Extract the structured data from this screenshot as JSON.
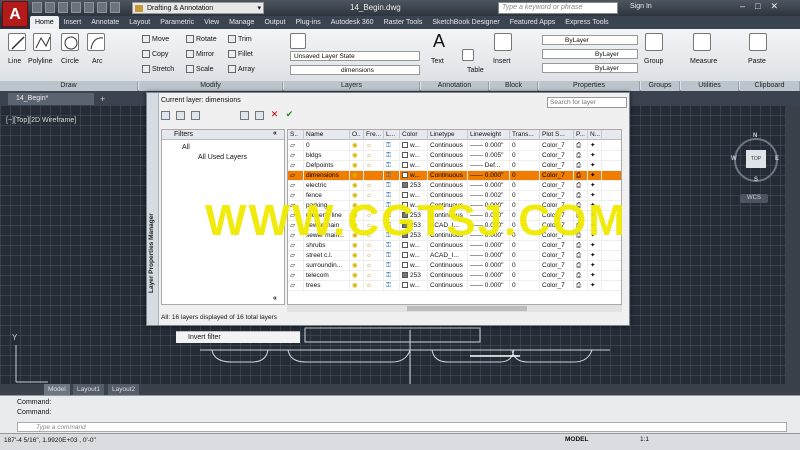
{
  "app": {
    "logo_letter": "A",
    "workspace": "Drafting & Annotation",
    "doc_title": "14_Begin.dwg",
    "search_placeholder": "Type a keyword or phrase",
    "sign_in": "Sign In"
  },
  "tabs": [
    "Home",
    "Insert",
    "Annotate",
    "Layout",
    "Parametric",
    "View",
    "Manage",
    "Output",
    "Plug-ins",
    "Autodesk 360",
    "Raster Tools",
    "SketchBook Designer",
    "Featured Apps",
    "Express Tools"
  ],
  "ribbon": {
    "draw": {
      "line": "Line",
      "polyline": "Polyline",
      "circle": "Circle",
      "arc": "Arc",
      "panel": "Draw"
    },
    "modify": {
      "move": "Move",
      "rotate": "Rotate",
      "trim": "Trim",
      "copy": "Copy",
      "mirror": "Mirror",
      "fillet": "Fillet",
      "stretch": "Stretch",
      "scale": "Scale",
      "array": "Array",
      "panel": "Modify"
    },
    "layers": {
      "state": "Unsaved Layer State",
      "current": "dimensions",
      "panel": "Layers"
    },
    "annotation": {
      "text": "Text",
      "table": "Table",
      "panel": "Annotation"
    },
    "block": {
      "insert": "Insert",
      "panel": "Block"
    },
    "properties": {
      "color": "ByLayer",
      "linetype": "ByLayer",
      "lineweight": "ByLayer",
      "panel": "Properties"
    },
    "groups": {
      "group": "Group",
      "panel": "Groups"
    },
    "utilities": {
      "measure": "Measure",
      "panel": "Utilities"
    },
    "clipboard": {
      "paste": "Paste",
      "panel": "Clipboard"
    }
  },
  "doc_tab": "14_Begin*",
  "view_label": "[−][Top][2D Wireframe]",
  "navcube": {
    "top": "TOP",
    "n": "N",
    "s": "S",
    "e": "E",
    "w": "W",
    "wcs": "WCS"
  },
  "layer_manager": {
    "side_title": "Layer Properties Manager",
    "current_layer": "Current layer: dimensions",
    "search_placeholder": "Search for layer",
    "filters_header": "Filters",
    "filter_all": "All",
    "filter_used": "All Used Layers",
    "invert_filter": "Invert filter",
    "columns": [
      "S..",
      "Name",
      "O..",
      "Fre...",
      "L...",
      "Color",
      "Linetype",
      "Lineweight",
      "Trans...",
      "Plot S...",
      "P...",
      "N..."
    ],
    "rows": [
      {
        "name": "0",
        "color": "w...",
        "linetype": "Continuous",
        "lineweight": "0.000\"",
        "trans": "0",
        "plot": "Color_7"
      },
      {
        "name": "bldgs",
        "color": "w...",
        "linetype": "Continuous",
        "lineweight": "0.005\"",
        "trans": "0",
        "plot": "Color_7"
      },
      {
        "name": "Defpoints",
        "color": "w...",
        "linetype": "Continuous",
        "lineweight": "Def...",
        "trans": "0",
        "plot": "Color_7"
      },
      {
        "name": "dimensions",
        "color": "w...",
        "linetype": "Continuous",
        "lineweight": "0.000\"",
        "trans": "0",
        "plot": "Color_7"
      },
      {
        "name": "electric",
        "color": "253",
        "linetype": "Continuous",
        "lineweight": "0.000\"",
        "trans": "0",
        "plot": "Color_7"
      },
      {
        "name": "fence",
        "color": "w...",
        "linetype": "Continuous",
        "lineweight": "0.002\"",
        "trans": "0",
        "plot": "Color_7"
      },
      {
        "name": "parking",
        "color": "w...",
        "linetype": "Continuous",
        "lineweight": "0.000\"",
        "trans": "0",
        "plot": "Color_7"
      },
      {
        "name": "property line",
        "color": "253",
        "linetype": "Continuous",
        "lineweight": "0.000\"",
        "trans": "0",
        "plot": "Color_7"
      },
      {
        "name": "sewer main",
        "color": "253",
        "linetype": "ACAD_I...",
        "lineweight": "0.000\"",
        "trans": "0",
        "plot": "Color_7"
      },
      {
        "name": "sewer main...",
        "color": "253",
        "linetype": "Continuous",
        "lineweight": "0.000\"",
        "trans": "0",
        "plot": "Color_7"
      },
      {
        "name": "shrubs",
        "color": "w...",
        "linetype": "Continuous",
        "lineweight": "0.000\"",
        "trans": "0",
        "plot": "Color_7"
      },
      {
        "name": "street c.l.",
        "color": "w...",
        "linetype": "ACAD_I...",
        "lineweight": "0.000\"",
        "trans": "0",
        "plot": "Color_7"
      },
      {
        "name": "surroundin...",
        "color": "w...",
        "linetype": "Continuous",
        "lineweight": "0.000\"",
        "trans": "0",
        "plot": "Color_7"
      },
      {
        "name": "telecom",
        "color": "253",
        "linetype": "Continuous",
        "lineweight": "0.000\"",
        "trans": "0",
        "plot": "Color_7"
      },
      {
        "name": "trees",
        "color": "w...",
        "linetype": "Continuous",
        "lineweight": "0.000\"",
        "trans": "0",
        "plot": "Color_7"
      }
    ],
    "selected_index": 3,
    "status": "All: 16 layers displayed of 16 total layers"
  },
  "watermark": "WWW.CGTSJ.COM",
  "model_tabs": [
    "Model",
    "Layout1",
    "Layout2"
  ],
  "command": {
    "line1": "Command:",
    "line2": "Command:",
    "placeholder": "Type a command"
  },
  "status": {
    "coords": "187'-4 5/16\", 1.9920E+03 , 0'-0\"",
    "model": "MODEL",
    "scale": "1:1"
  },
  "colors": {
    "selected_row": "#f07c00",
    "canvas": "#252c36",
    "watermark": "#f0ea00"
  }
}
